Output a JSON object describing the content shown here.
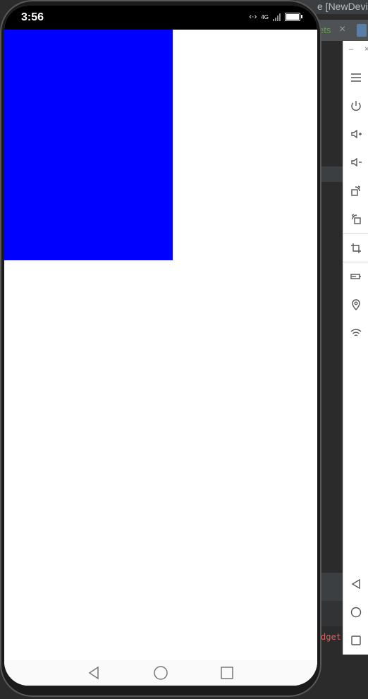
{
  "ide": {
    "title_fragment": "e [NewDevic",
    "tab_label": "ets",
    "tab_close": "×",
    "code_fragment": "dget"
  },
  "emulator_toolbar": {
    "minimize_label": "–",
    "close_label": "×",
    "buttons": [
      {
        "icon": "menu-icon"
      },
      {
        "icon": "power-icon"
      },
      {
        "icon": "volume-up-icon"
      },
      {
        "icon": "volume-down-icon"
      },
      {
        "icon": "rotate-left-icon"
      },
      {
        "icon": "rotate-right-icon"
      },
      {
        "icon": "screenshot-icon"
      },
      {
        "icon": "battery-icon"
      },
      {
        "icon": "location-icon"
      },
      {
        "icon": "wifi-icon"
      },
      {
        "icon": "back-icon"
      },
      {
        "icon": "home-icon"
      },
      {
        "icon": "overview-icon"
      }
    ]
  },
  "phone": {
    "status_time": "3:56",
    "network_label": "4G",
    "content_box_color": "#0000ff"
  },
  "nav_bar": {
    "buttons": [
      "back-icon",
      "home-icon",
      "recents-icon"
    ]
  }
}
